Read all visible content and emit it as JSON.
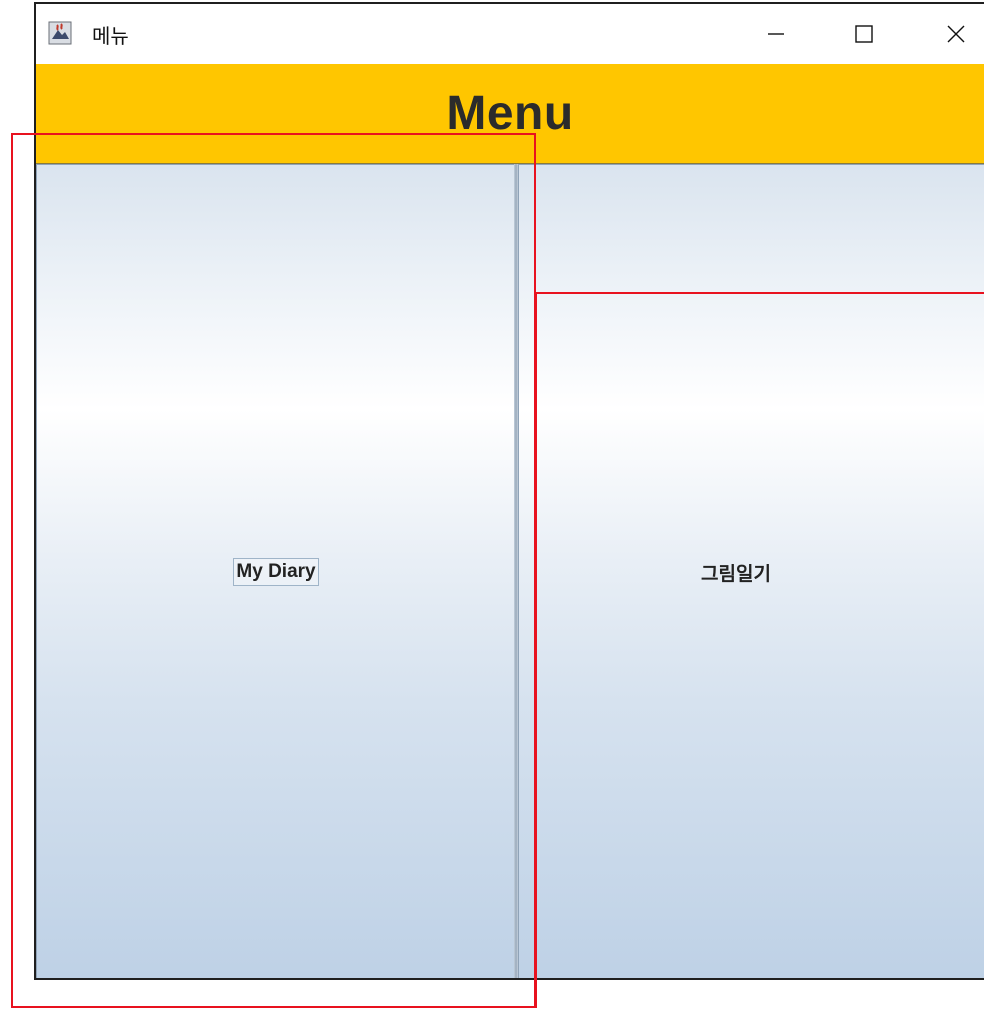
{
  "window": {
    "title": "메뉴",
    "icon": "java-app-icon",
    "controls": {
      "minimize": "minimize-icon",
      "maximize": "maximize-icon",
      "close": "close-icon"
    }
  },
  "header": {
    "title": "Menu",
    "background": "#ffc600"
  },
  "buttons": {
    "left_label": "My Diary",
    "right_label": "그림일기"
  },
  "colors": {
    "annotation": "#e8121f",
    "button_gradient_bottom": "#bed1e6"
  }
}
